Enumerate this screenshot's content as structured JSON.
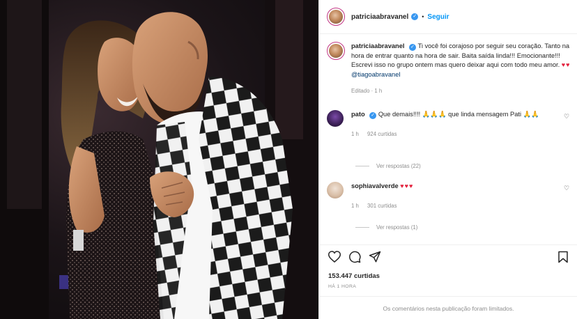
{
  "post": {
    "username": "patriciaabravanel",
    "follow_label": "Seguir",
    "caption_text": "Ti você foi corajoso por seguir seu coração. Tanto na hora de entrar quanto na hora de sair. Baita saída linda!!! Emocionante!!! Escrevi isso no grupo ontem mas quero deixar aqui com todo meu amor.",
    "caption_hearts": "♥♥",
    "caption_mention": "@tiagoabravanel",
    "caption_meta": "Editado · 1 h"
  },
  "comments": [
    {
      "username": "pato",
      "text": "Que demais!!!! 🙏🙏🙏 que linda mensagem Pati 🙏🙏",
      "time": "1 h",
      "likes": "924 curtidas",
      "replies": "Ver respostas (22)"
    },
    {
      "username": "sophiavalverde",
      "text": "♥♥♥",
      "time": "1 h",
      "likes": "301 curtidas",
      "replies": "Ver respostas (1)"
    }
  ],
  "footer": {
    "likes": "153.447 curtidas",
    "time": "HÁ 1 HORA",
    "limited_notice": "Os comentários nesta publicação foram limitados."
  },
  "colors": {
    "accent": "#0095f6",
    "heart": "#e3203c",
    "muted": "#8e8e8e"
  },
  "icons": [
    "like-icon",
    "comment-icon",
    "share-icon",
    "save-icon",
    "verified-icon"
  ]
}
